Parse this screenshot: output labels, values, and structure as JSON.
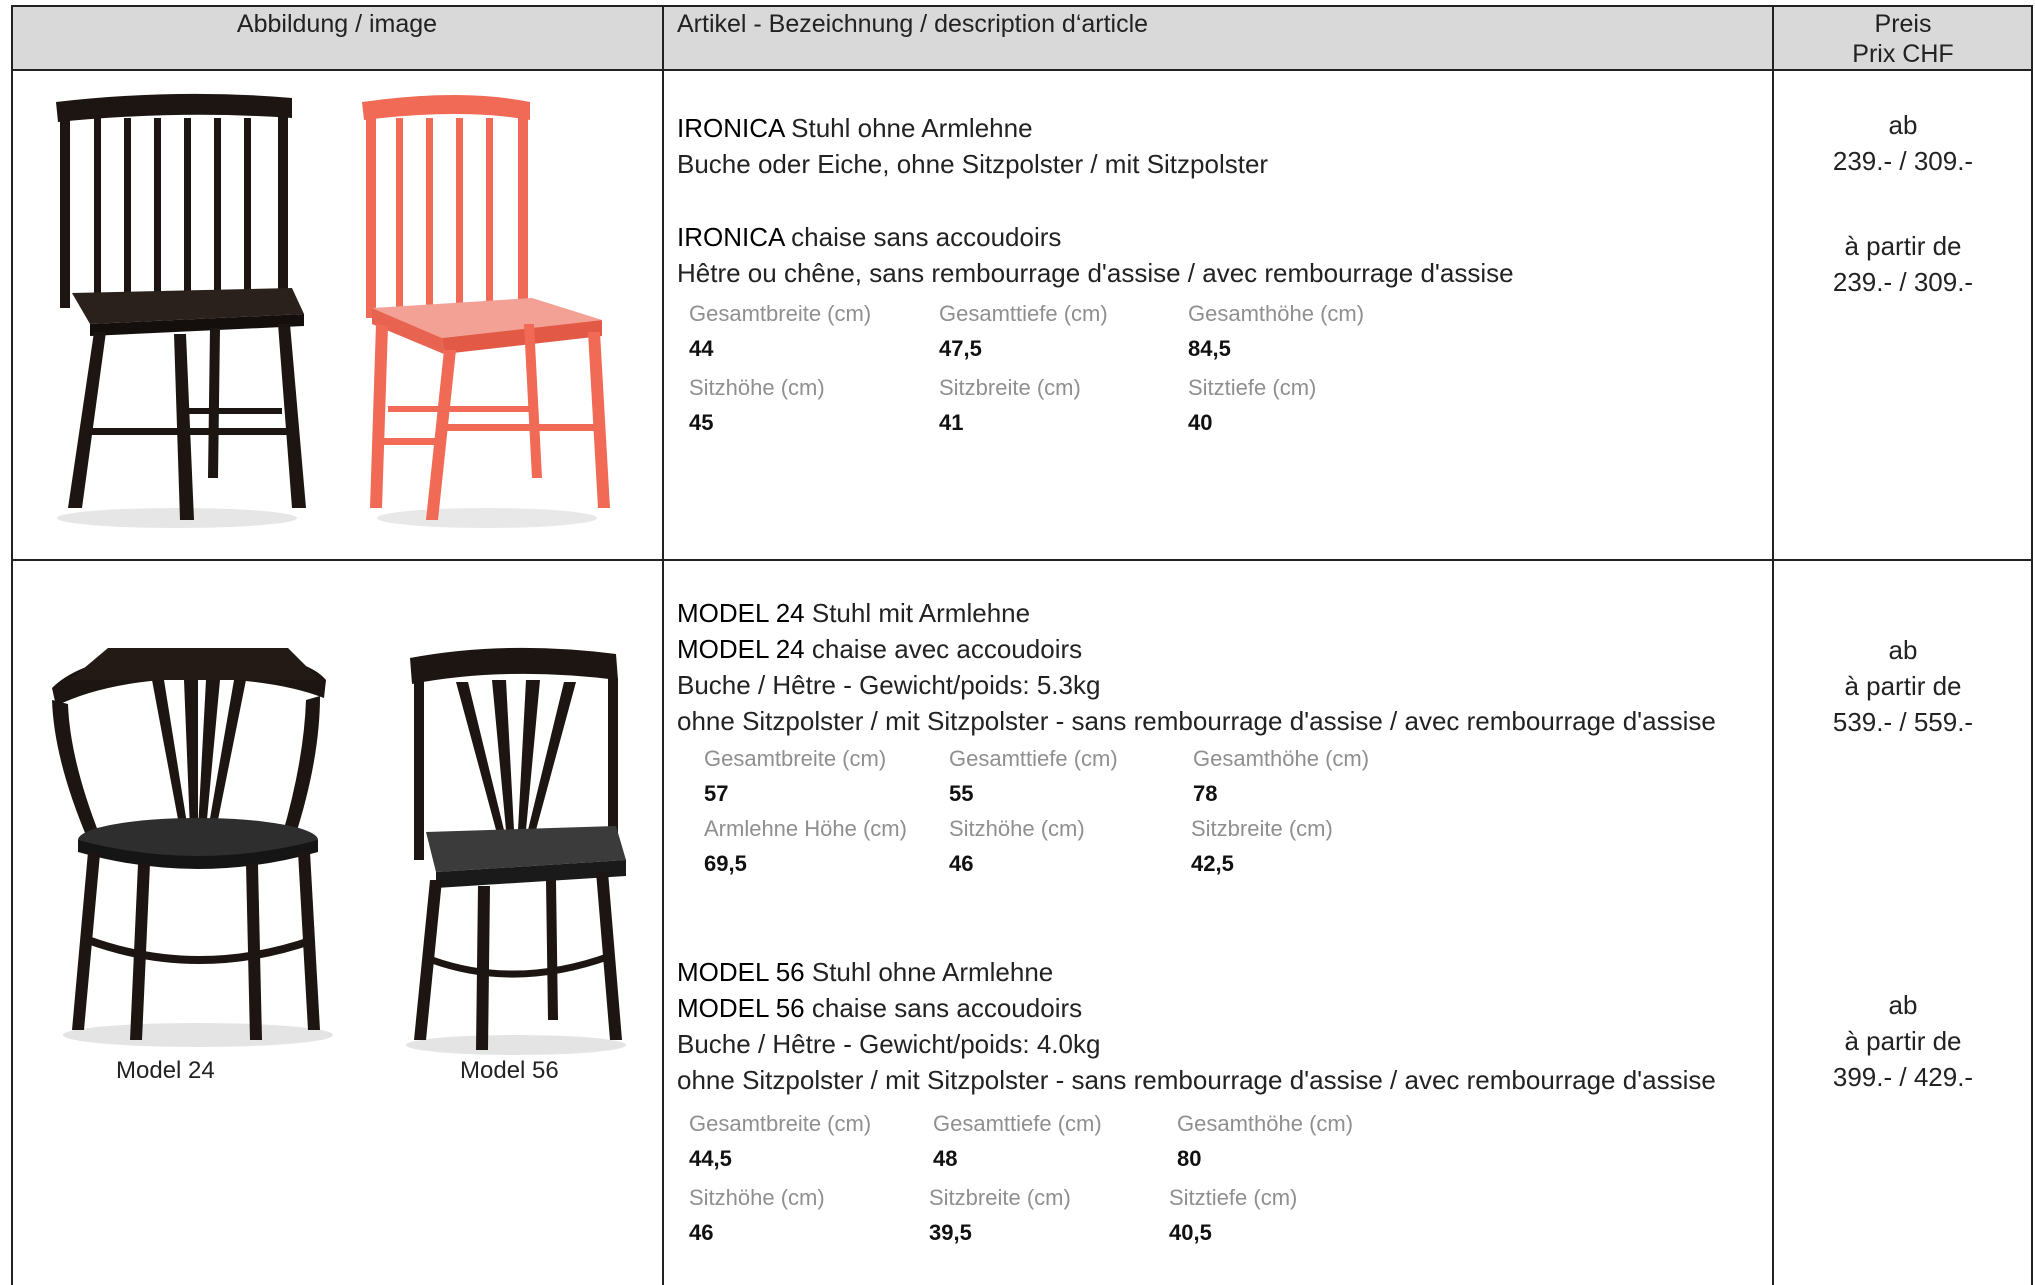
{
  "header": {
    "col_image": "Abbildung / image",
    "col_description": "Artikel - Bezeichnung / description d‘article",
    "col_price_line1": "Preis",
    "col_price_line2": "Prix CHF"
  },
  "colors": {
    "header_bg": "#d9d9d9",
    "chair_dark": "#1c1512",
    "chair_red": "#f06a55",
    "seat_grey": "#3b3b3b"
  },
  "ironica": {
    "de_title": "IRONICA",
    "de_rest": " Stuhl ohne Armlehne",
    "de_line2": "Buche oder Eiche, ohne Sitzpolster / mit Sitzpolster",
    "fr_title": "IRONICA",
    "fr_rest": " chaise sans accoudoirs",
    "fr_line2": "Hêtre ou chêne, sans rembourrage d'assise / avec rembourrage d'assise",
    "dims": [
      {
        "label": "Gesamtbreite (cm)",
        "value": "44"
      },
      {
        "label": "Gesamttiefe (cm)",
        "value": "47,5"
      },
      {
        "label": "Gesamthöhe (cm)",
        "value": "84,5"
      },
      {
        "label": "Sitzhöhe (cm)",
        "value": "45"
      },
      {
        "label": "Sitzbreite (cm)",
        "value": "41"
      },
      {
        "label": "Sitztiefe (cm)",
        "value": "40"
      }
    ],
    "price": {
      "de_prefix": "ab",
      "de_value": "239.- / 309.-",
      "fr_prefix": "à partir de",
      "fr_value": "239.- / 309.-"
    }
  },
  "model24": {
    "de_title": "MODEL 24",
    "de_rest": " Stuhl mit Armlehne",
    "fr_title": "MODEL 24",
    "fr_rest": " chaise avec accoudoirs",
    "line3": "Buche / Hêtre - Gewicht/poids: 5.3kg",
    "line4": "ohne Sitzpolster / mit Sitzpolster - sans rembourrage d'assise / avec rembourrage d'assise",
    "dims": [
      {
        "label": "Gesamtbreite (cm)",
        "value": "57"
      },
      {
        "label": "Gesamttiefe (cm)",
        "value": "55"
      },
      {
        "label": "Gesamthöhe (cm)",
        "value": "78"
      },
      {
        "label": "Armlehne Höhe (cm)",
        "value": "69,5"
      },
      {
        "label": "Sitzhöhe (cm)",
        "value": "46"
      },
      {
        "label": "Sitzbreite (cm)",
        "value": "42,5"
      }
    ],
    "price": {
      "prefix_de": "ab",
      "prefix_fr": "à partir de",
      "value": "539.- / 559.-"
    },
    "caption": "Model 24"
  },
  "model56": {
    "de_title": "MODEL 56",
    "de_rest": " Stuhl ohne Armlehne",
    "fr_title": "MODEL 56",
    "fr_rest": " chaise sans accoudoirs",
    "line3": "Buche / Hêtre - Gewicht/poids: 4.0kg",
    "line4": "ohne Sitzpolster / mit Sitzpolster - sans rembourrage d'assise / avec rembourrage d'assise",
    "dims": [
      {
        "label": "Gesamtbreite (cm)",
        "value": "44,5"
      },
      {
        "label": "Gesamttiefe (cm)",
        "value": "48"
      },
      {
        "label": "Gesamthöhe (cm)",
        "value": "80"
      },
      {
        "label": "Sitzhöhe (cm)",
        "value": "46"
      },
      {
        "label": "Sitzbreite (cm)",
        "value": "39,5"
      },
      {
        "label": "Sitztiefe (cm)",
        "value": "40,5"
      }
    ],
    "price": {
      "prefix_de": "ab",
      "prefix_fr": "à partir de",
      "value": "399.- / 429.-"
    },
    "caption": "Model 56"
  }
}
